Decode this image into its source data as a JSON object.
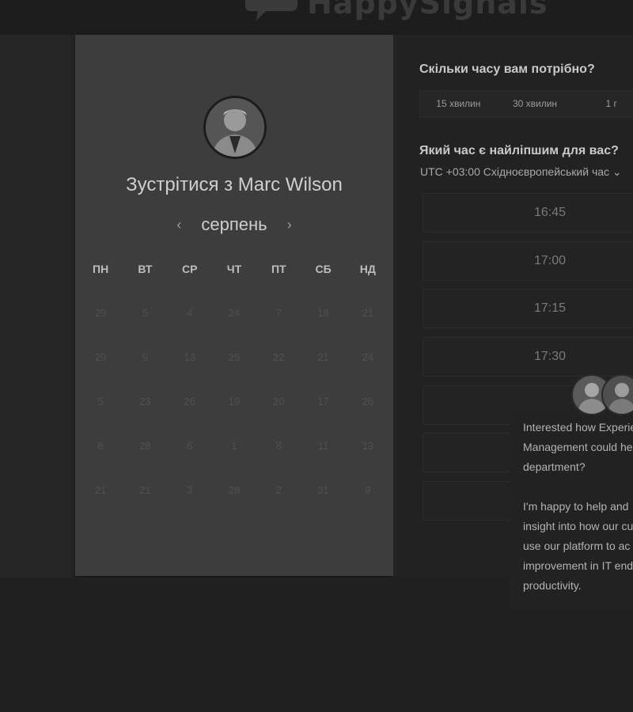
{
  "header": {
    "logo_text": "HappySignals"
  },
  "calendar": {
    "title": "Зустрітися з Marc Wilson",
    "month": "серпень",
    "prev_icon": "‹",
    "next_icon": "›",
    "weekdays": [
      "ПН",
      "ВТ",
      "СР",
      "ЧТ",
      "ПТ",
      "СБ",
      "НД"
    ],
    "weeks": [
      [
        "29",
        "5",
        "4",
        "24",
        "7",
        "18",
        "21"
      ],
      [
        "29",
        "9",
        "13",
        "25",
        "22",
        "21",
        "24"
      ],
      [
        "5",
        "23",
        "26",
        "19",
        "20",
        "17",
        "26"
      ],
      [
        "6",
        "28",
        "6",
        "1",
        "8",
        "11",
        "13"
      ],
      [
        "21",
        "21",
        "3",
        "28",
        "2",
        "31",
        "9"
      ]
    ]
  },
  "duration": {
    "question": "Скільки часу вам потрібно?",
    "options": [
      "15 хвилин",
      "30 хвилин",
      "1 г"
    ]
  },
  "time": {
    "question": "Який час є найліпшим для вас?",
    "timezone": "UTC +03:00 Східноєвропейський час",
    "slots": [
      "16:45",
      "17:00",
      "17:15",
      "17:30",
      "",
      "",
      ""
    ]
  },
  "chat": {
    "line1": "Interested how Experie",
    "line2": "Management could he",
    "line3": "department?",
    "line4": "I'm happy to help and",
    "line5": "insight into how our cu",
    "line6": "use our platform to ac",
    "line7": "improvement in IT end",
    "line8": "productivity."
  }
}
